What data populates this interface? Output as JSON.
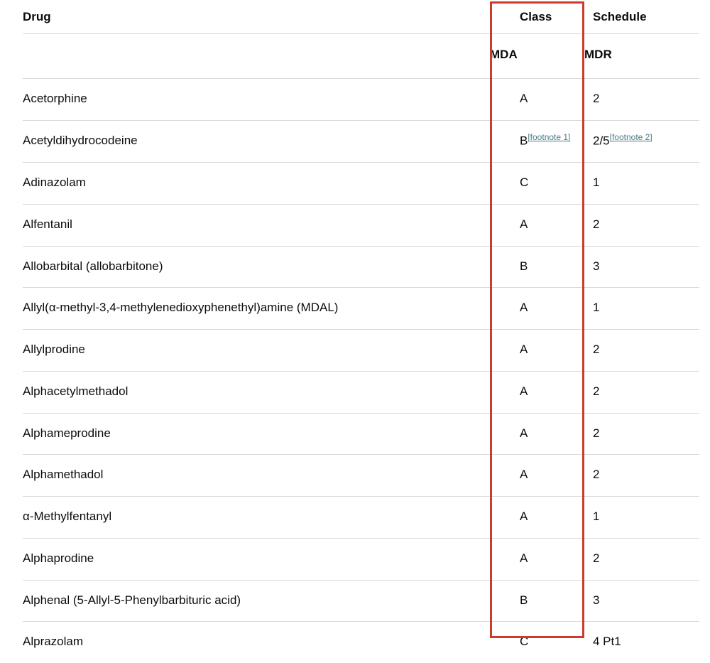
{
  "table": {
    "headers": {
      "drug": "Drug",
      "class": "Class",
      "schedule": "Schedule"
    },
    "subheaders": {
      "drug": "",
      "class": "MDA",
      "schedule": "MDR"
    },
    "rows": [
      {
        "drug": "Acetorphine",
        "class": "A",
        "class_footnote": "",
        "schedule": "2",
        "schedule_footnote": ""
      },
      {
        "drug": "Acetyldihydrocodeine",
        "class": "B",
        "class_footnote": "[footnote 1]",
        "schedule": "2/5",
        "schedule_footnote": "[footnote 2]"
      },
      {
        "drug": "Adinazolam",
        "class": "C",
        "class_footnote": "",
        "schedule": "1",
        "schedule_footnote": ""
      },
      {
        "drug": "Alfentanil",
        "class": "A",
        "class_footnote": "",
        "schedule": "2",
        "schedule_footnote": ""
      },
      {
        "drug": "Allobarbital (allobarbitone)",
        "class": "B",
        "class_footnote": "",
        "schedule": "3",
        "schedule_footnote": ""
      },
      {
        "drug": "Allyl(α-methyl-3,4-methylenedioxyphenethyl)amine (MDAL)",
        "class": "A",
        "class_footnote": "",
        "schedule": "1",
        "schedule_footnote": ""
      },
      {
        "drug": "Allylprodine",
        "class": "A",
        "class_footnote": "",
        "schedule": "2",
        "schedule_footnote": ""
      },
      {
        "drug": "Alphacetylmethadol",
        "class": "A",
        "class_footnote": "",
        "schedule": "2",
        "schedule_footnote": ""
      },
      {
        "drug": "Alphameprodine",
        "class": "A",
        "class_footnote": "",
        "schedule": "2",
        "schedule_footnote": ""
      },
      {
        "drug": "Alphamethadol",
        "class": "A",
        "class_footnote": "",
        "schedule": "2",
        "schedule_footnote": ""
      },
      {
        "drug": "α-Methylfentanyl",
        "class": "A",
        "class_footnote": "",
        "schedule": "1",
        "schedule_footnote": ""
      },
      {
        "drug": "Alphaprodine",
        "class": "A",
        "class_footnote": "",
        "schedule": "2",
        "schedule_footnote": ""
      },
      {
        "drug": "Alphenal (5-Allyl-5-Phenylbarbituric acid)",
        "class": "B",
        "class_footnote": "",
        "schedule": "3",
        "schedule_footnote": ""
      },
      {
        "drug": "Alprazolam",
        "class": "C",
        "class_footnote": "",
        "schedule": "4 Pt1",
        "schedule_footnote": ""
      }
    ]
  },
  "annotation": {
    "highlight_color": "#cc3b2b",
    "highlighted_column": "Class"
  },
  "colors": {
    "text": "#0b0c0c",
    "link": "#4c7b84",
    "border": "#d8d8d8",
    "background": "#ffffff"
  }
}
